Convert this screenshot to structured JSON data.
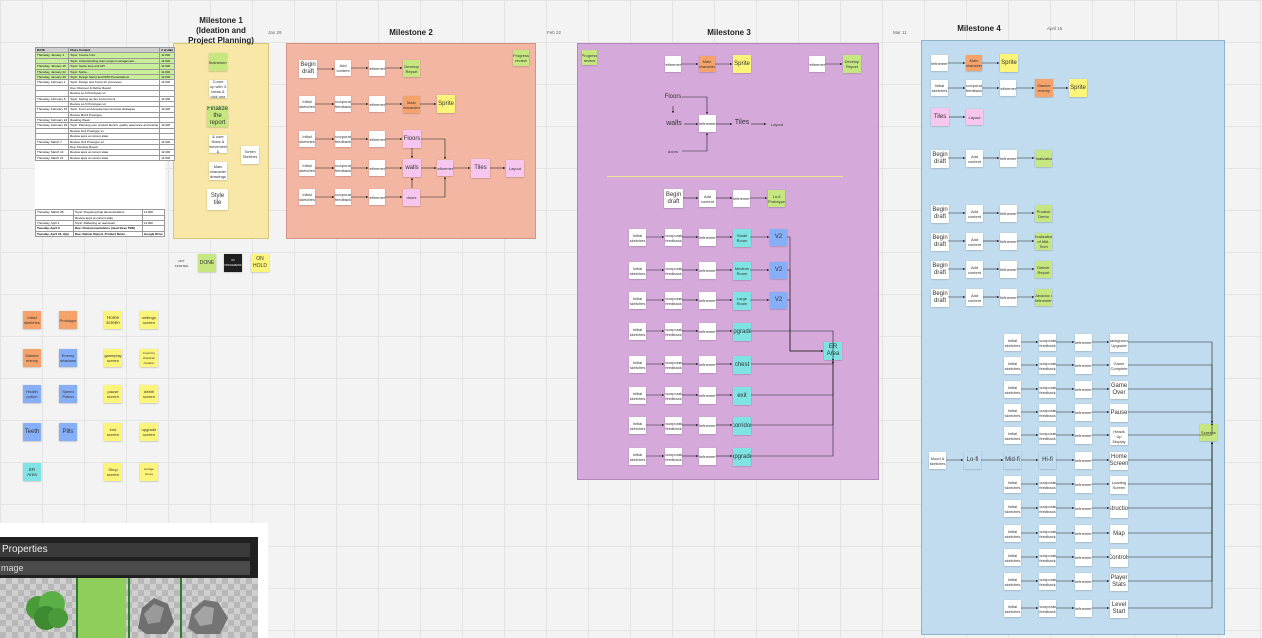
{
  "milestones": {
    "m1_title": "Milestone 1\n(Ideation and\nProject Planning)",
    "m1_date": "Jan 29",
    "m2_title": "Milestone 2",
    "m2_date": "Feb 22",
    "m3_title": "Milestone 3",
    "m3_date": "Mar 11",
    "m4_title": "Milestone 4",
    "m4_date": "April 15"
  },
  "colors": {
    "yellow_frame": "#f8e7a6",
    "salmon_frame": "#f2b6a3",
    "purple_frame": "#d5aadb",
    "blue_frame": "#c2dcef",
    "sticky_white": "#ffffff",
    "sticky_orange": "#f5a36b",
    "sticky_yellow": "#fdf57a",
    "sticky_green": "#c6e680",
    "sticky_blue": "#86aff7",
    "sticky_pink": "#f7c6ef",
    "sticky_teal": "#7fe3e3",
    "sticky_black": "#1e1e1e"
  },
  "schedule": {
    "headers": [
      "DATE",
      "Class Content",
      "# visible"
    ],
    "rows": [
      [
        "Thursday, January 1",
        "Topic: Course Intro",
        "11:000"
      ],
      [
        "",
        "Topic: Understanding team project management...",
        "11:000"
      ],
      [
        "Thursday, January 15",
        "Topic: Game loop and API",
        "11:000"
      ],
      [
        "Thursday, January 22",
        "Topic: Sprite...",
        "11:000"
      ],
      [
        "Thursday, January 29",
        "Topic: Design Sprint and PRD Presentations",
        "11:000"
      ],
      [
        "Thursday, February 1",
        "Topic: Design and Comp for processes",
        "11:000"
      ],
      [
        "",
        "Due: Discover & Define Report",
        ""
      ],
      [
        "",
        "Review Lo-fi Prototypes v1",
        ""
      ],
      [
        "Thursday, February 8",
        "Topic: Setting up dev environment",
        "11:000"
      ],
      [
        "",
        "Review Lo-fi Prototypes v2",
        ""
      ],
      [
        "Thursday, February 15",
        "Topic: Front end development and test strategies",
        "11:000"
      ],
      [
        "",
        "Review Mid-fi Prototype",
        ""
      ],
      [
        "Thursday, February 22",
        "Reading Week",
        ""
      ],
      [
        "Thursday, February 29",
        "Topic: Planning your product launch, quality assurance and testing",
        "11:000"
      ],
      [
        "",
        "Review Hi-fi Prototype v1",
        ""
      ],
      [
        "",
        "Review apps at current state",
        ""
      ],
      [
        "Thursday, March 7",
        "Review Hi-fi Prototype v2",
        "11:000"
      ],
      [
        "",
        "Due: Develop Report",
        ""
      ],
      [
        "Thursday, March 14",
        "Review apps at current state",
        "11:000"
      ],
      [
        "Thursday, March 21",
        "Review apps at current state",
        "11:000"
      ]
    ],
    "rows_b": [
      [
        "Thursday, March 28",
        "Topic: Preparing final demonstrations",
        "11:000"
      ],
      [
        "",
        "Review apps at current state",
        ""
      ],
      [
        "Thursday, April 4",
        "Topic: Reflecting on teamwork",
        "11:000"
      ],
      [
        "Tuesday, April 9",
        "Due: Final presentations (need three TBD)",
        ""
      ],
      [
        "Tuesday, April 16, 2pm",
        "Due: Deliver Report, Product Demo",
        "Google Drive"
      ]
    ]
  },
  "status_legend": {
    "not_started": "NOT STARTED",
    "done": "DONE",
    "in_progress": "IN PROGRESS",
    "on_hold": "ON HOLD"
  },
  "m1": {
    "s1": "Brainstorm",
    "s2": "Come up with 3 ideas & pick one",
    "s3": "Finalize the report",
    "s4": "Brainstorm & user flows & movement & interactions",
    "s5": "Main character drawings",
    "s6": "Style tile",
    "s7": "Screen Sketches"
  },
  "m2": {
    "progress": "Progress review",
    "r1": [
      "Begin draft",
      "Add content",
      "Refinement",
      "Develop Report"
    ],
    "r2": [
      "Initial sketches",
      "Incorporate feedback",
      "Refinement",
      "Main characters",
      "Sprite"
    ],
    "r3": [
      "Initial sketches",
      "Incorporate feedback",
      "Refinement",
      "Floors"
    ],
    "r4": [
      "Initial sketches",
      "Incorporate feedback",
      "Refinement",
      "walls",
      "Refinement",
      "Tiles",
      "Layout"
    ],
    "r5": [
      "Initial sketches",
      "Incorporate feedback",
      "Refinement",
      "doors"
    ]
  },
  "m3": {
    "top_left": "Progress review",
    "a1": [
      "Refinement",
      "Main character",
      "Sprite",
      "Refinement",
      "Develop Report"
    ],
    "a2": [
      "Floors",
      "walls",
      "Refinement",
      "Tiles",
      "Layout",
      "doors"
    ],
    "b": [
      "Begin draft",
      "Add content",
      "Refinement",
      "Lo-fi Prototype"
    ],
    "rooms": [
      [
        "Initial sketches",
        "Incorporate feedback",
        "Refinement",
        "Small Room",
        "V2"
      ],
      [
        "Initial sketches",
        "Incorporate feedback",
        "Refinement",
        "Medium Room",
        "V2"
      ],
      [
        "Initial sketches",
        "Incorporate feedback",
        "Refinement",
        "Large Room",
        "V2"
      ],
      [
        "Initial sketches",
        "Incorporate feedback",
        "Refinement",
        "Upgrades"
      ],
      [
        "Initial sketches",
        "Incorporate feedback",
        "Refinement",
        "chest"
      ],
      [
        "Initial sketches",
        "Incorporate feedback",
        "Refinement",
        "exit"
      ],
      [
        "Initial sketches",
        "Incorporate feedback",
        "Refinement",
        "corridor"
      ],
      [
        "Initial sketches",
        "Incorporate feedback",
        "Refinement",
        "upgrade"
      ]
    ],
    "er_area": "ER Area"
  },
  "m4": {
    "t1": [
      "Refinement",
      "Main character",
      "Sprite"
    ],
    "t2": [
      "Initial sketches",
      "Incorporate feedback",
      "Refinement",
      "Slasher enemy",
      "Sprite"
    ],
    "t3": [
      "Tiles",
      "Layout"
    ],
    "d1": [
      "Begin draft",
      "Add content",
      "Refinement",
      "Finalization"
    ],
    "d2": [
      "Begin draft",
      "Add content",
      "Refinement",
      "Product Demo"
    ],
    "d3": [
      "Begin draft",
      "Add content",
      "Refinement",
      "Realization of Mid-Tech"
    ],
    "d4": [
      "Begin draft",
      "Add content",
      "Refinement",
      "Deliver Report"
    ],
    "d5": [
      "Begin draft",
      "Add content",
      "Refinement",
      "Javadoc / Refinement"
    ],
    "screens": [
      [
        "Initial sketches",
        "Incorporate feedback",
        "Refinement",
        "Background Upgrade"
      ],
      [
        "Initial sketches",
        "Incorporate feedback",
        "Refinement",
        "Game Complete"
      ],
      [
        "Initial sketches",
        "Incorporate feedback",
        "Refinement",
        "Game Over"
      ],
      [
        "Initial sketches",
        "Incorporate feedback",
        "Refinement",
        "Pause"
      ],
      [
        "Initial sketches",
        "Incorporate feedback",
        "Refinement",
        "Heads Up Display"
      ],
      [
        "Mood & sketches",
        "Lo-fi",
        "Mid-fi",
        "Hi-fi",
        "Refinement",
        "Home Screen"
      ],
      [
        "Initial sketches",
        "Incorporate feedback",
        "Refinement",
        "Loading Screen"
      ],
      [
        "Initial sketches",
        "Incorporate feedback",
        "Refinement",
        "Instructions"
      ],
      [
        "Initial sketches",
        "Incorporate feedback",
        "Refinement",
        "Map"
      ],
      [
        "Initial sketches",
        "Incorporate feedback",
        "Refinement",
        "Controls"
      ],
      [
        "Initial sketches",
        "Incorporate feedback",
        "Refinement",
        "Player Stats"
      ],
      [
        "Initial sketches",
        "Incorporate feedback",
        "Refinement",
        "Level Start"
      ]
    ],
    "end": "Screens"
  },
  "left_palette": {
    "p1": "Initial sketches",
    "p2": "Prototype",
    "p3": "Home screen",
    "p4": "settings screen",
    "p5": "Slasher enemy",
    "p6": "Enemy shadows",
    "p7": "gameplay screen",
    "p8": "inventory character creation",
    "p9": "Health potion",
    "p10": "Speed Potion",
    "p11": "pause screen",
    "p12": "death screen",
    "p13": "Teeth",
    "p14": "Pills",
    "p15": "end screen",
    "p16": "upgrade screen",
    "p17": "ER Area",
    "p18": "Shop screen",
    "p19": "storage boxes"
  },
  "window": {
    "title": "Properties",
    "subtitle": "mage"
  }
}
